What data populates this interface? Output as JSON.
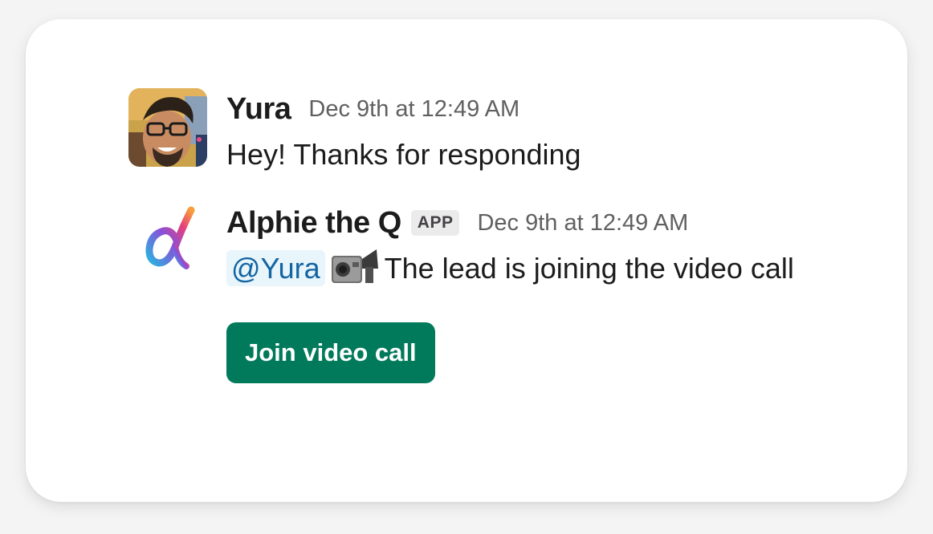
{
  "messages": [
    {
      "sender": "Yura",
      "timestamp": "Dec 9th at 12:49 AM",
      "avatar_icon": "user-photo-avatar",
      "text": "Hey! Thanks for responding"
    },
    {
      "sender": "Alphie the Q",
      "badge": "APP",
      "timestamp": "Dec 9th at 12:49 AM",
      "avatar_icon": "alpha-logo-icon",
      "mention": "@Yura",
      "emoji_icon": "video-camera-icon",
      "text": "The lead is joining the video call",
      "button_label": "Join video call"
    }
  ],
  "colors": {
    "button": "#007a5a",
    "mention_bg": "#e8f5fa",
    "mention_text": "#1264a3"
  }
}
